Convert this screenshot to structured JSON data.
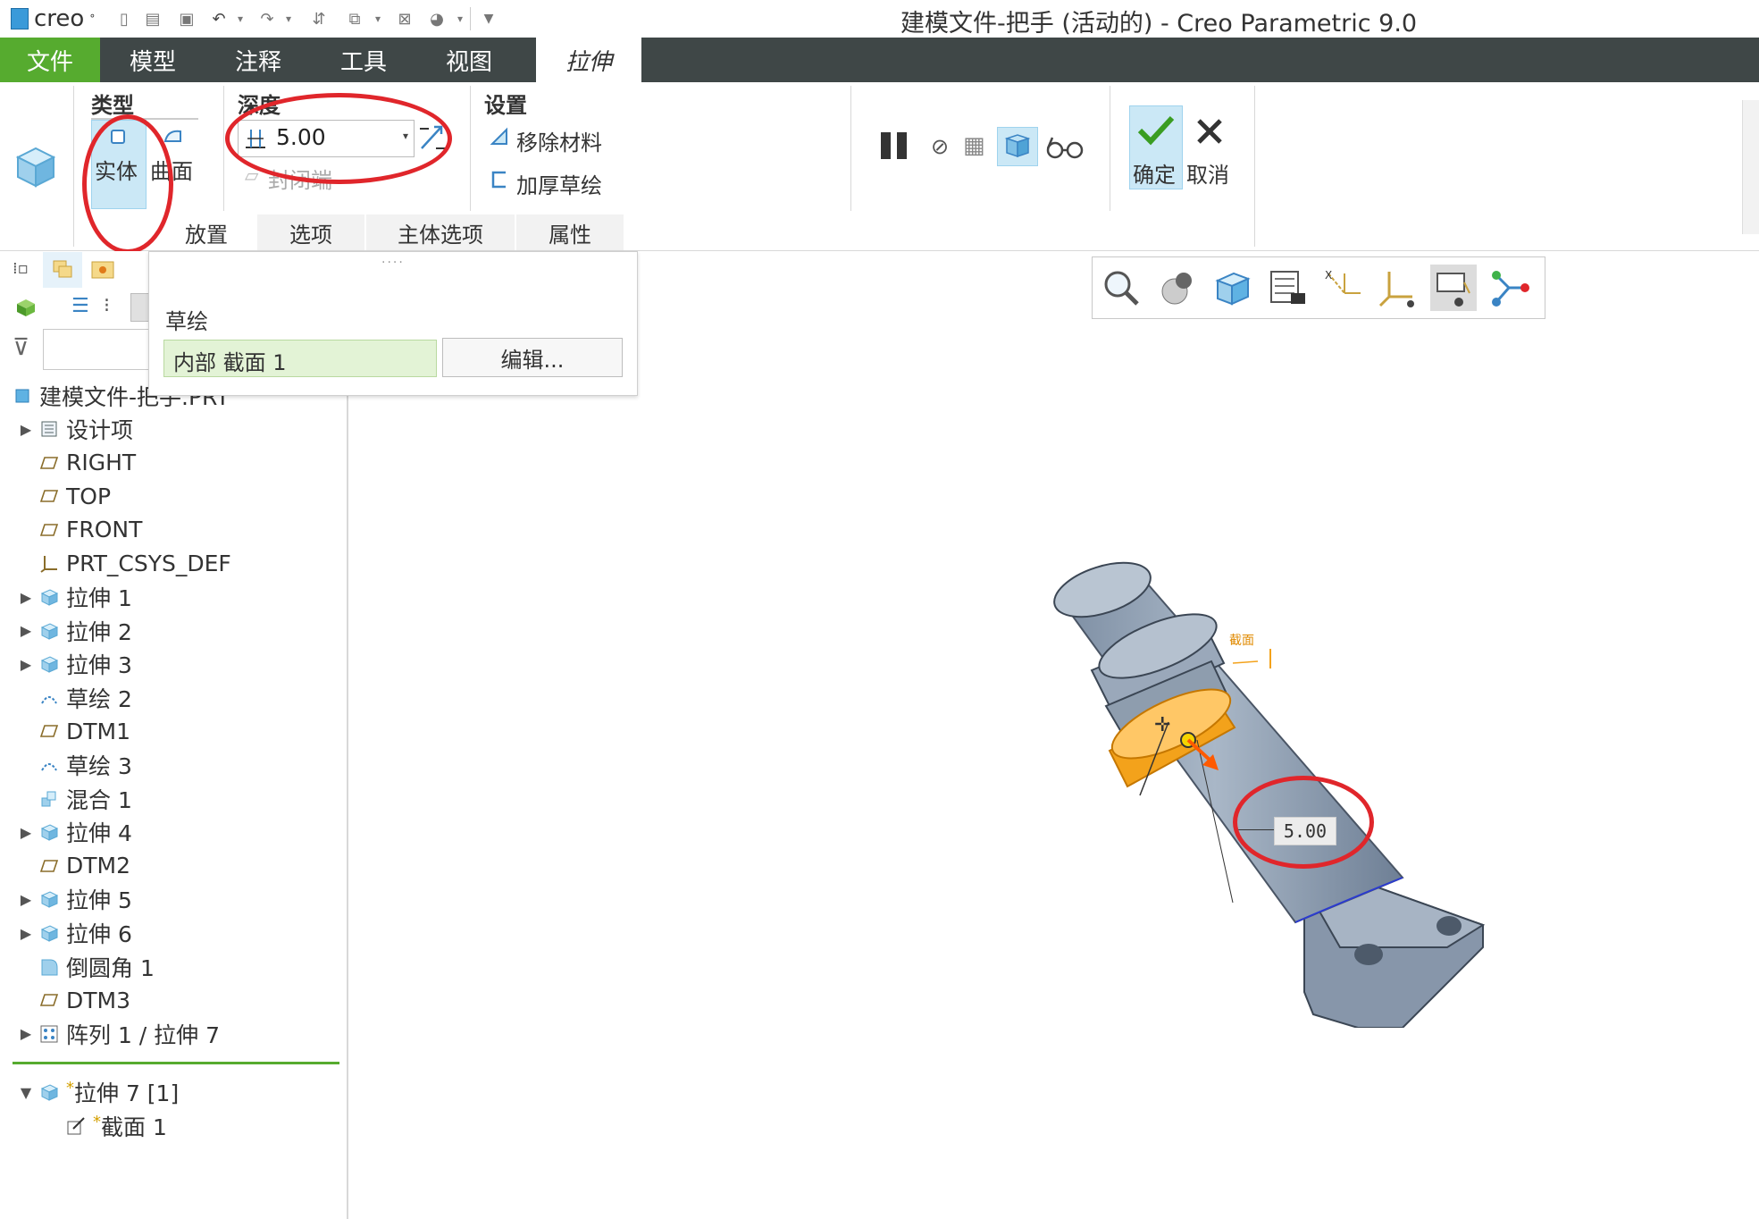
{
  "titlebar": {
    "logo_text": "creo",
    "window_title": "建模文件-把手 (活动的) - Creo Parametric 9.0"
  },
  "menu": {
    "file": "文件",
    "model": "模型",
    "annotate": "注释",
    "tools": "工具",
    "view": "视图",
    "extrude": "拉伸"
  },
  "ribbon": {
    "type_title": "类型",
    "solid": "实体",
    "surface": "曲面",
    "depth_title": "深度",
    "depth_value": "5.00",
    "cap_ends": "封闭端",
    "settings_title": "设置",
    "remove_material": "移除材料",
    "thicken_sketch": "加厚草绘",
    "ok": "确定",
    "cancel": "取消",
    "subtabs": [
      "放置",
      "选项",
      "主体选项",
      "属性"
    ]
  },
  "popup": {
    "sketch_label": "草绘",
    "section_value": "内部 截面 1",
    "edit_button": "编辑..."
  },
  "tree": {
    "root": "建模文件-把手.PRT",
    "items": [
      {
        "label": "设计项",
        "icon": "design-items-icon",
        "expand": true
      },
      {
        "label": "RIGHT",
        "icon": "datum-plane-icon",
        "expand": false
      },
      {
        "label": "TOP",
        "icon": "datum-plane-icon",
        "expand": false
      },
      {
        "label": "FRONT",
        "icon": "datum-plane-icon",
        "expand": false
      },
      {
        "label": "PRT_CSYS_DEF",
        "icon": "csys-icon",
        "expand": false
      },
      {
        "label": "拉伸 1",
        "icon": "extrude-icon",
        "expand": true
      },
      {
        "label": "拉伸 2",
        "icon": "extrude-icon",
        "expand": true
      },
      {
        "label": "拉伸 3",
        "icon": "extrude-icon",
        "expand": true
      },
      {
        "label": "草绘 2",
        "icon": "sketch-icon",
        "expand": false
      },
      {
        "label": "DTM1",
        "icon": "datum-plane-icon",
        "expand": false
      },
      {
        "label": "草绘 3",
        "icon": "sketch-icon",
        "expand": false
      },
      {
        "label": "混合 1",
        "icon": "blend-icon",
        "expand": false
      },
      {
        "label": "拉伸 4",
        "icon": "extrude-icon",
        "expand": true
      },
      {
        "label": "DTM2",
        "icon": "datum-plane-icon",
        "expand": false
      },
      {
        "label": "拉伸 5",
        "icon": "extrude-icon",
        "expand": true
      },
      {
        "label": "拉伸 6",
        "icon": "extrude-icon",
        "expand": true
      },
      {
        "label": "倒圆角 1",
        "icon": "round-icon",
        "expand": false
      },
      {
        "label": "DTM3",
        "icon": "datum-plane-icon",
        "expand": false
      },
      {
        "label": "阵列 1 / 拉伸 7",
        "icon": "pattern-icon",
        "expand": true
      }
    ],
    "active_feature": "拉伸 7 [1]",
    "active_child": "截面 1",
    "new_marker": "*"
  },
  "viewport": {
    "dimension_value": "5.00",
    "section_tag": "截面"
  },
  "colors": {
    "menubar": "#3f4747",
    "file_tab": "#56ab2f",
    "highlight": "#cbe8f6",
    "annotation": "#e0262b",
    "model_body": "#8e9dae",
    "section_ring": "#f3a21b"
  }
}
